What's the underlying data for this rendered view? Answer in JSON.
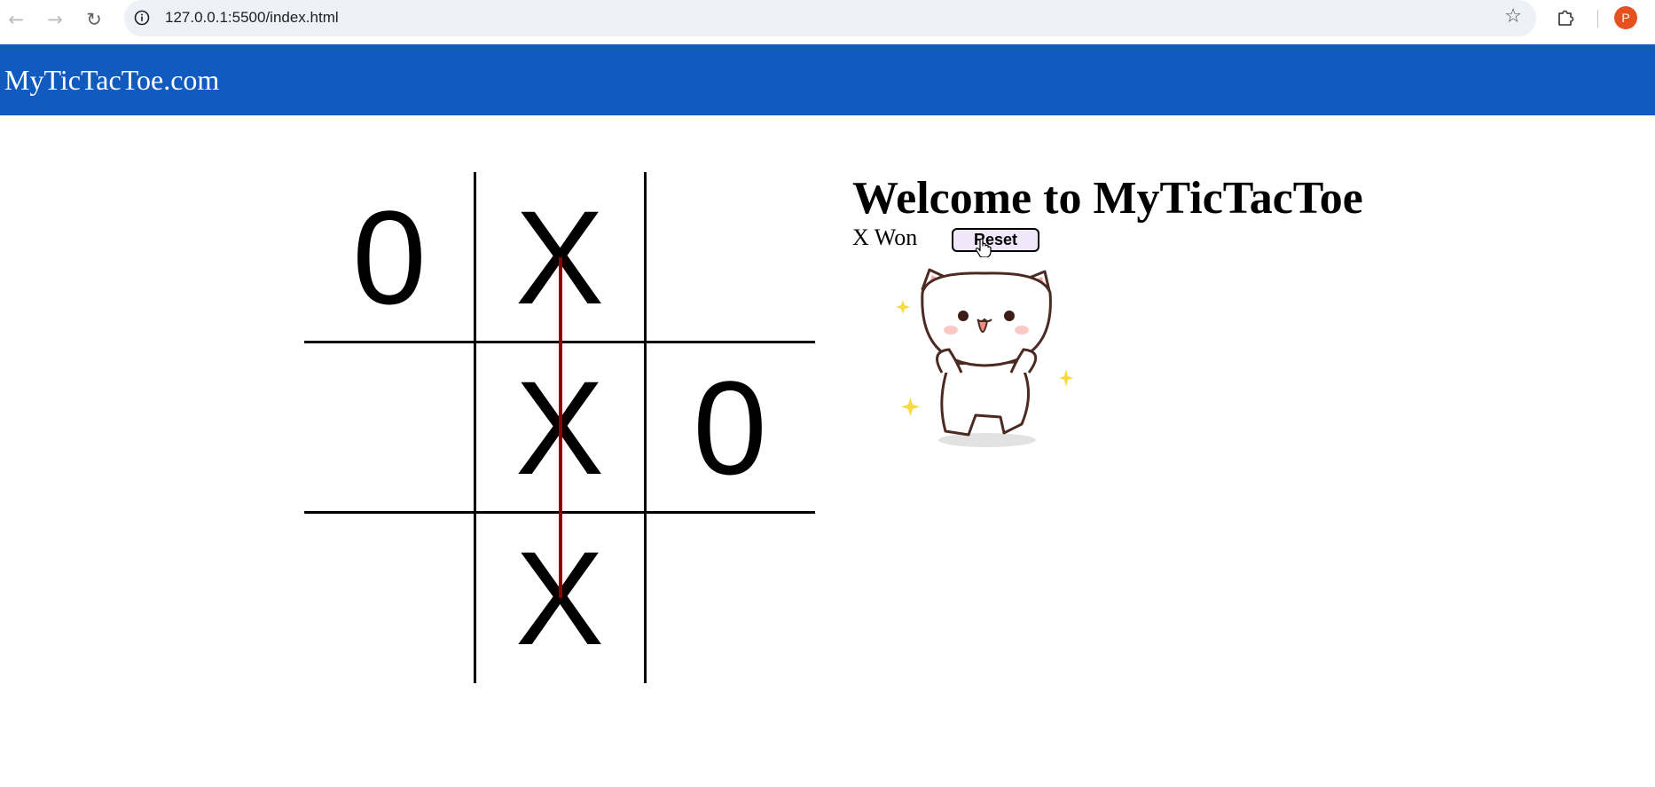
{
  "browser": {
    "url": "127.0.0.1:5500/index.html",
    "back_icon": "arrow-left-icon",
    "forward_icon": "arrow-right-icon",
    "reload_icon": "reload-icon",
    "bookmark_icon": "star-icon",
    "extensions_icon": "puzzle-icon",
    "profile_initial": "P",
    "profile_color": "#e8501f"
  },
  "site": {
    "brand": "MyTicTacToe.com",
    "header_color": "#115abf"
  },
  "game": {
    "title": "Welcome to MyTicTacToe",
    "status": "X Won",
    "reset_label": "Reset",
    "board": [
      [
        "0",
        "X",
        ""
      ],
      [
        "",
        "X",
        "0"
      ],
      [
        "",
        "X",
        ""
      ]
    ],
    "winning_line": {
      "type": "column",
      "index": 1,
      "color": "#8b0000"
    },
    "celebration_image": "dancing-cat"
  }
}
